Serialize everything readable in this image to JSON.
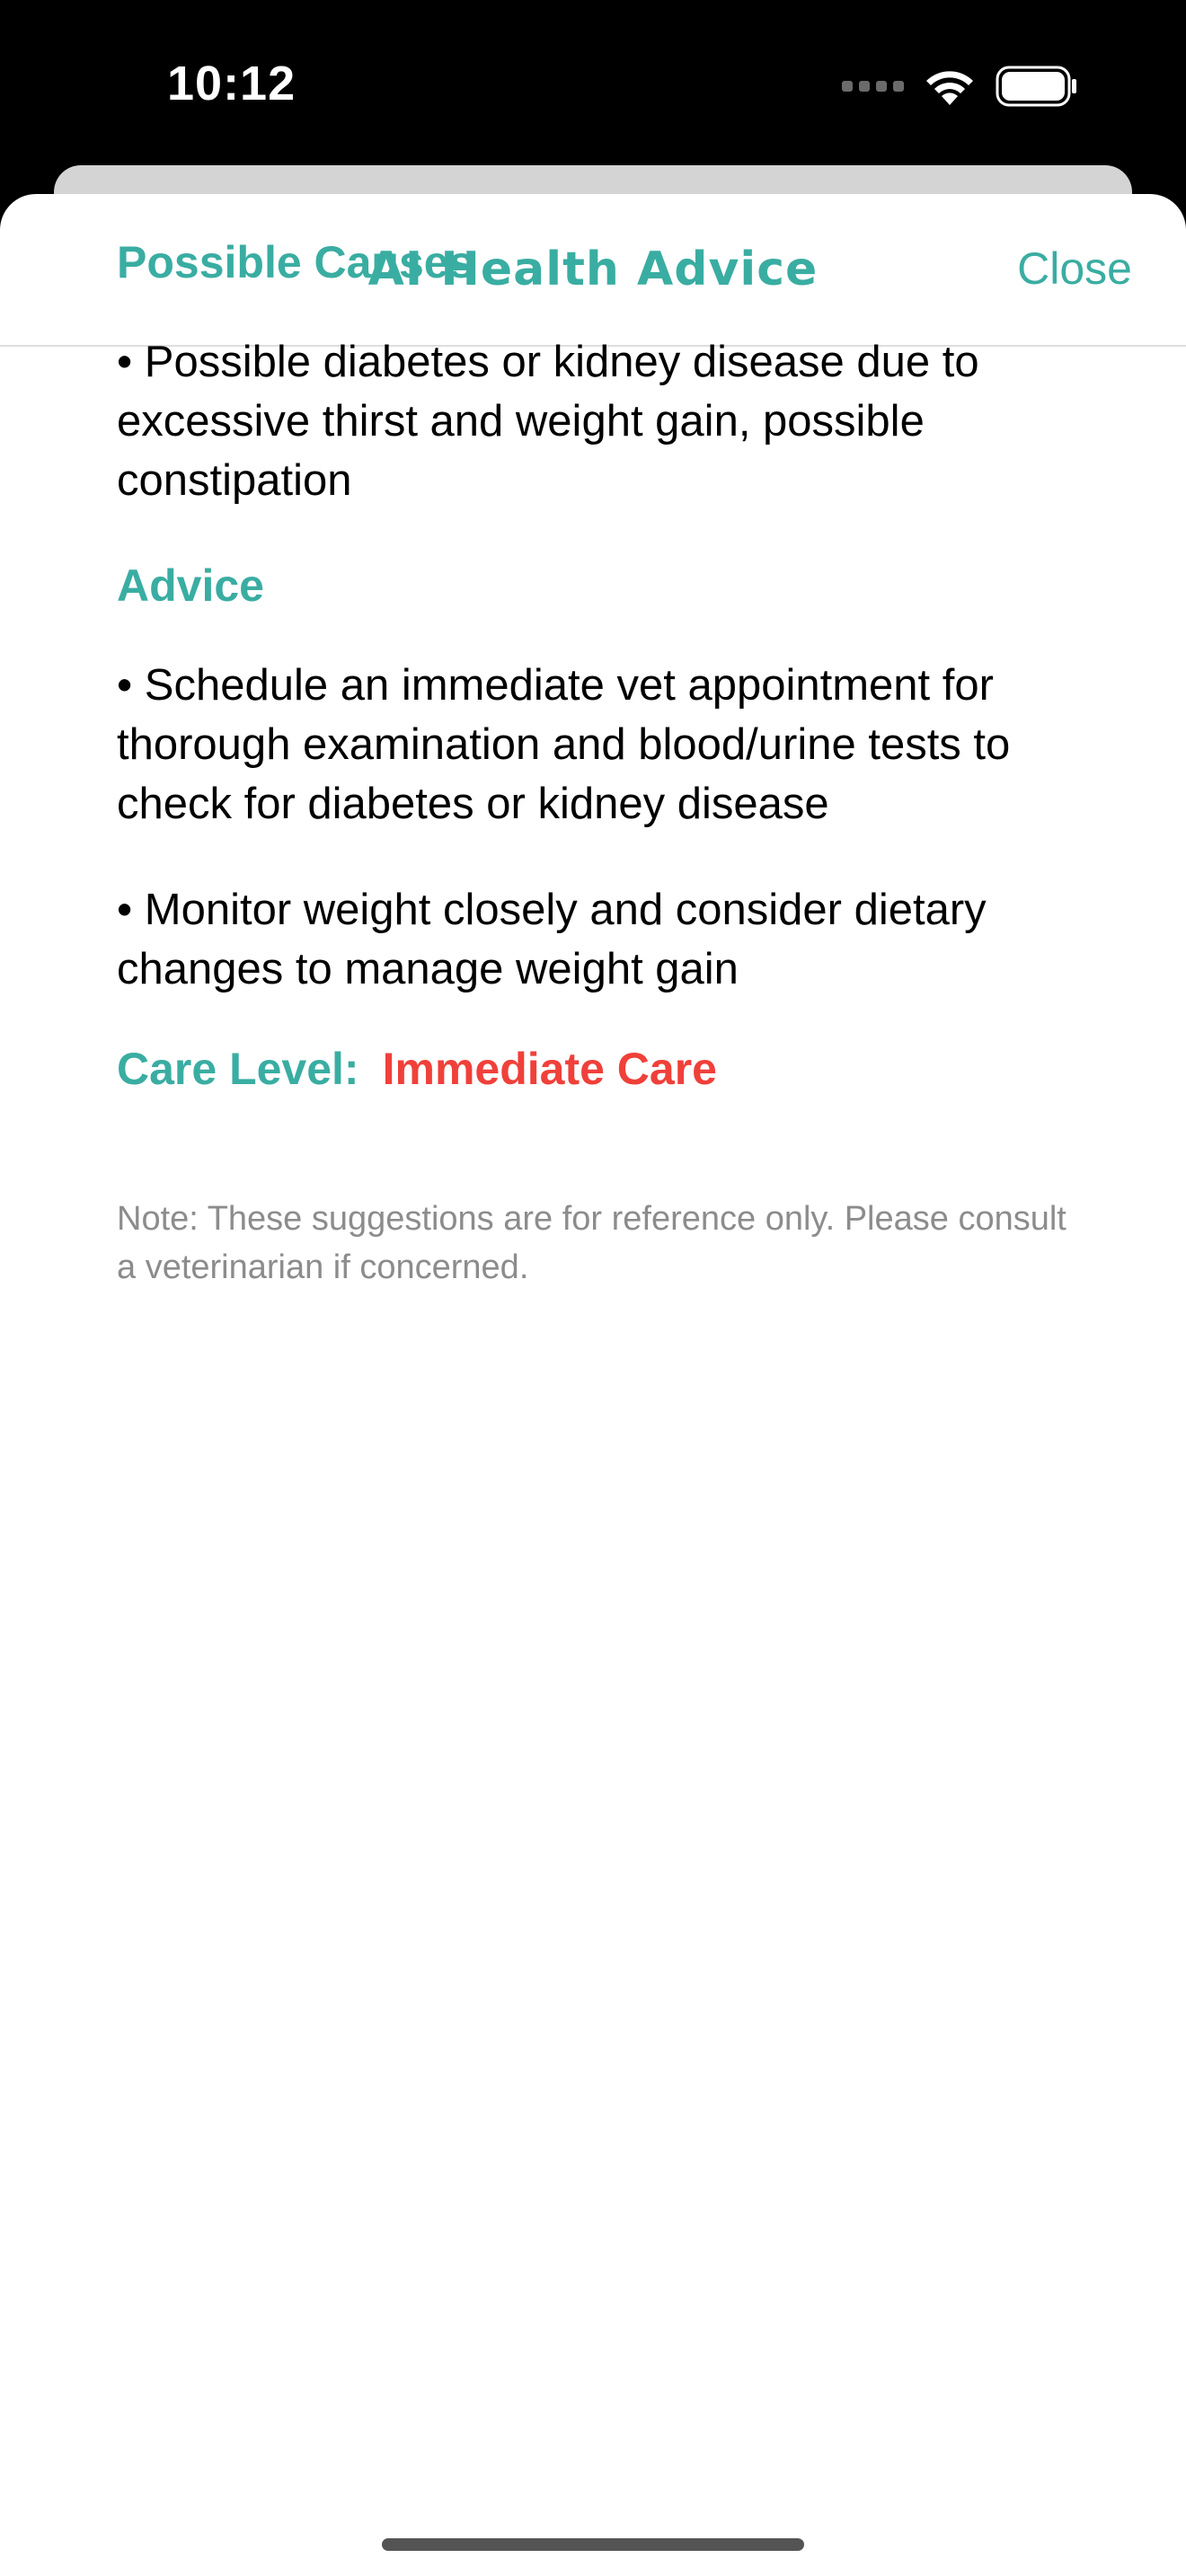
{
  "status_bar": {
    "time": "10:12",
    "icons": [
      "signal-dots-icon",
      "wifi-icon",
      "battery-icon"
    ]
  },
  "nav": {
    "title": "AI Health Advice",
    "close_label": "Close"
  },
  "sections": {
    "causes_heading": "Possible Causes",
    "causes_items": [
      "• Possible diabetes or kidney disease due to excessive thirst and weight gain, possible constipation"
    ],
    "advice_heading": "Advice",
    "advice_items": [
      "• Schedule an immediate vet appointment for thorough examination and blood/urine tests to check for diabetes or kidney disease",
      "• Monitor weight closely and consider dietary changes to manage weight gain"
    ]
  },
  "care": {
    "label": "Care Level:",
    "value": "Immediate Care"
  },
  "note": "Note: These suggestions are for reference only. Please consult a veterinarian if concerned.",
  "colors": {
    "accent": "#3aada2",
    "alert": "#f0403a",
    "note": "#8c8c8c"
  }
}
